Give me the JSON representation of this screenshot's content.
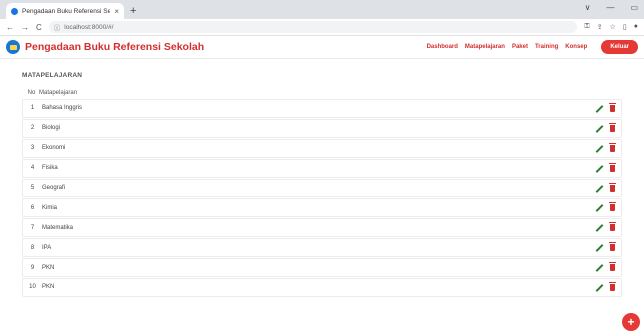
{
  "browser": {
    "tab_title": "Pengadaan Buku Referensi Sekolah",
    "tab_close": "×",
    "new_tab": "+",
    "url": "localhost:8000/#/",
    "window_controls": [
      "∨",
      "—",
      "▭"
    ]
  },
  "app": {
    "brand": "Pengadaan Buku Referensi Sekolah",
    "menu": [
      "Dashboard",
      "Matapelajaran",
      "Paket",
      "Training",
      "Konsep"
    ],
    "logout_label": "Keluar"
  },
  "page": {
    "title": "MATAPELAJARAN",
    "columns": {
      "no": "No",
      "name": "Matapelajaran"
    },
    "rows": [
      {
        "no": "1",
        "name": "Bahasa Inggris"
      },
      {
        "no": "2",
        "name": "Biologi"
      },
      {
        "no": "3",
        "name": "Ekonomi"
      },
      {
        "no": "4",
        "name": "Fisika"
      },
      {
        "no": "5",
        "name": "Geografi"
      },
      {
        "no": "6",
        "name": "Kimia"
      },
      {
        "no": "7",
        "name": "Matematika"
      },
      {
        "no": "8",
        "name": "IPA"
      },
      {
        "no": "9",
        "name": "PKN"
      },
      {
        "no": "10",
        "name": "PKN"
      }
    ],
    "fab_label": "+"
  },
  "colors": {
    "accent": "#e53935",
    "edit": "#2e7d32",
    "brand": "#d32f2f"
  },
  "icons": {
    "edit": "pencil-icon",
    "delete": "trash-icon"
  }
}
